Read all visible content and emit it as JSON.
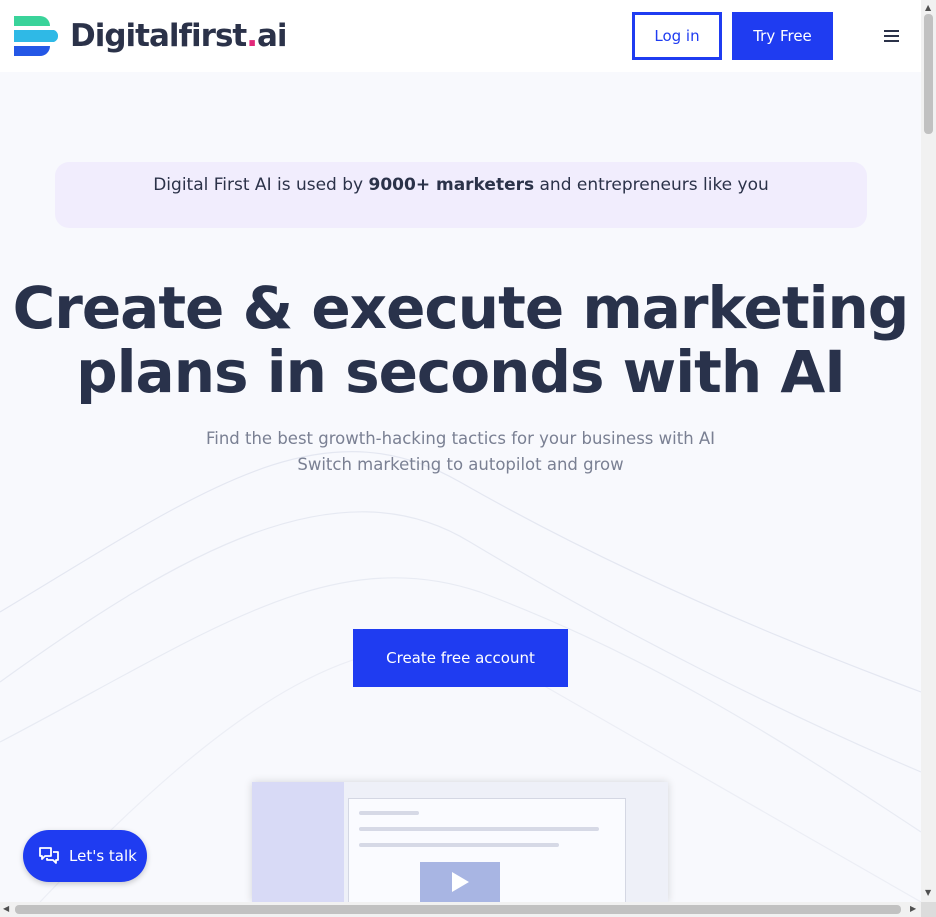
{
  "header": {
    "logo_text": "Digitalfirst",
    "logo_dot": ".",
    "logo_suffix": "ai",
    "login_label": "Log in",
    "try_label": "Try Free"
  },
  "banner": {
    "prefix": "Digital First AI is used by ",
    "highlight": "9000+ marketers",
    "suffix": " and entrepreneurs like you"
  },
  "hero": {
    "title_line1": "Create & execute marketing",
    "title_line2": "plans in seconds with AI",
    "sub_line1": "Find the best growth-hacking tactics for your business with AI",
    "sub_line2": "Switch marketing to autopilot and grow"
  },
  "cta": {
    "label": "Create free account"
  },
  "chat": {
    "label": "Let's talk"
  },
  "icons": [
    "logo-mark-icon",
    "hamburger-menu-icon",
    "play-icon",
    "chat-bubbles-icon"
  ],
  "colors": {
    "accent": "#1f3cf1",
    "text": "#2b3249",
    "banner_bg": "#f1edfd",
    "logo_dot": "#e2287a"
  }
}
